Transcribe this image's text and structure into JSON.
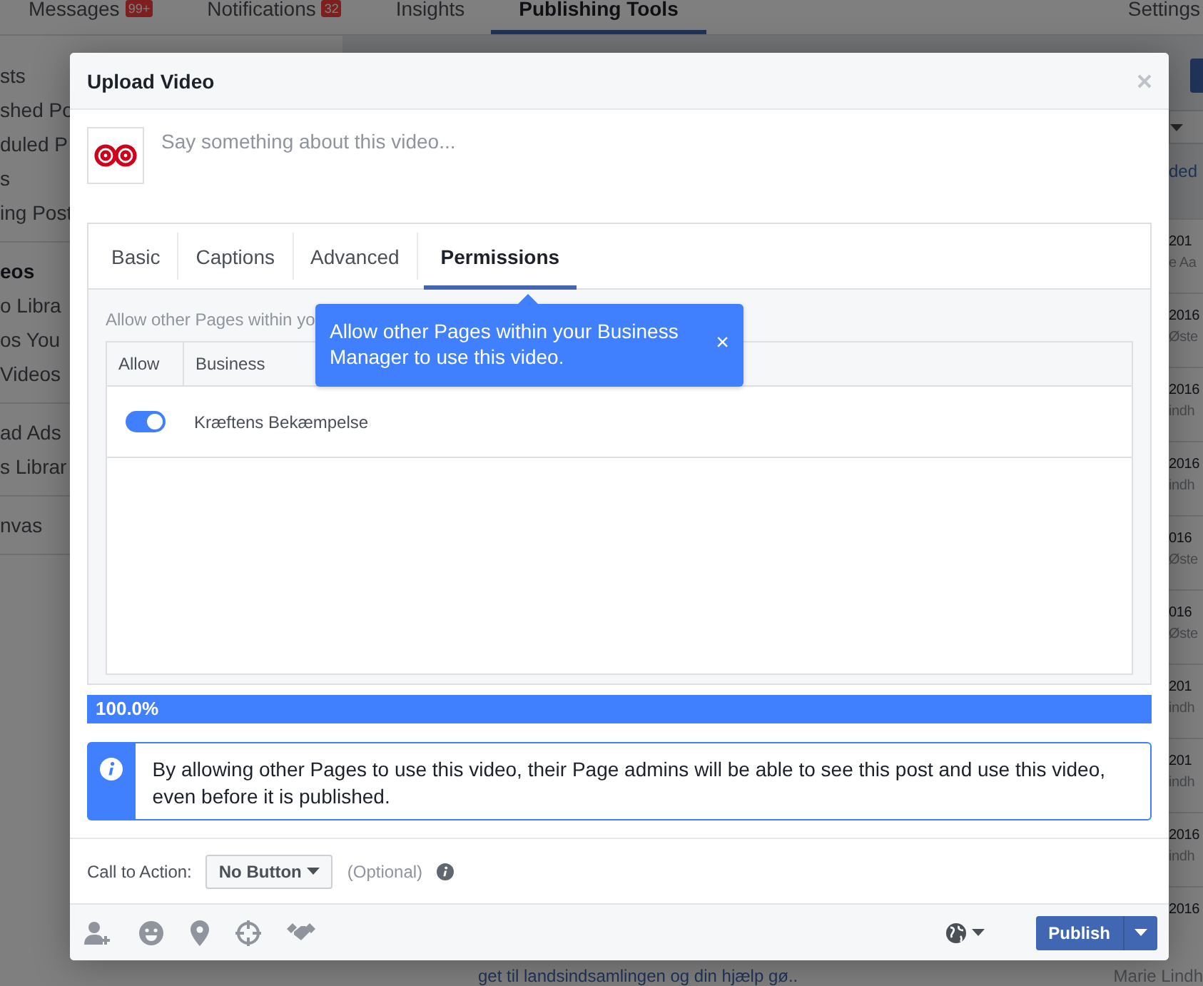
{
  "nav": {
    "tabs": [
      {
        "label": "Messages",
        "badge": "99+",
        "selected": false
      },
      {
        "label": "Notifications",
        "badge": "32",
        "selected": false
      },
      {
        "label": "Insights",
        "selected": false
      },
      {
        "label": "Publishing Tools",
        "selected": true
      },
      {
        "label": "Settings",
        "selected": false
      }
    ]
  },
  "sidebar": {
    "groups": [
      {
        "items": [
          {
            "label": "sts",
            "bold": false
          },
          {
            "label": "shed Po",
            "bold": false
          },
          {
            "label": "duled P",
            "bold": false
          },
          {
            "label": "s",
            "bold": false
          },
          {
            "label": "ing Post",
            "bold": false
          }
        ]
      },
      {
        "items": [
          {
            "label": "eos",
            "bold": true
          },
          {
            "label": "o Libra",
            "bold": false
          },
          {
            "label": "os You",
            "bold": false
          },
          {
            "label": "Videos",
            "bold": false
          }
        ]
      },
      {
        "items": [
          {
            "label": "ad Ads",
            "bold": false
          },
          {
            "label": "s Librar",
            "bold": false
          }
        ]
      },
      {
        "items": [
          {
            "label": "nvas",
            "bold": false
          }
        ]
      }
    ]
  },
  "list": {
    "link": "ded",
    "rows": [
      {
        "date": "201",
        "name": "e Aa"
      },
      {
        "date": "2016",
        "name": "Øste"
      },
      {
        "date": "2016",
        "name": "indh"
      },
      {
        "date": "2016",
        "name": "indh"
      },
      {
        "date": "016",
        "name": "Øste"
      },
      {
        "date": "016",
        "name": "Øste"
      },
      {
        "date": "201",
        "name": "indh"
      },
      {
        "date": "201",
        "name": "indh"
      },
      {
        "date": "2016",
        "name": "indh"
      },
      {
        "date": "2016"
      }
    ],
    "footer_text": "get til landsindsamlingen og din hjælp gø..",
    "footer_name": "Marie Lindh"
  },
  "dialog": {
    "title": "Upload Video",
    "composer": {
      "placeholder": "Say something about this video..."
    },
    "tabs": [
      {
        "label": "Basic",
        "selected": false
      },
      {
        "label": "Captions",
        "selected": false
      },
      {
        "label": "Advanced",
        "selected": false
      },
      {
        "label": "Permissions",
        "selected": true
      }
    ],
    "intro": "Allow other Pages within yo",
    "tooltip": {
      "text": "Allow other Pages within your Business Manager to use this video.",
      "close": "×"
    },
    "table": {
      "columns": [
        "Allow",
        "Business"
      ],
      "rows": [
        {
          "on": true,
          "business": "Kræftens Bekæmpelse"
        }
      ]
    },
    "progress": {
      "level": 1.0,
      "reading": "100.0%"
    },
    "notice": "By allowing other Pages to use this video, their Page admins will be able to see this post and use this video, even before it is published.",
    "call_to_action": {
      "label": "Call to Action:",
      "value": "No Button",
      "hint": "(Optional)"
    },
    "publish": "Publish"
  }
}
